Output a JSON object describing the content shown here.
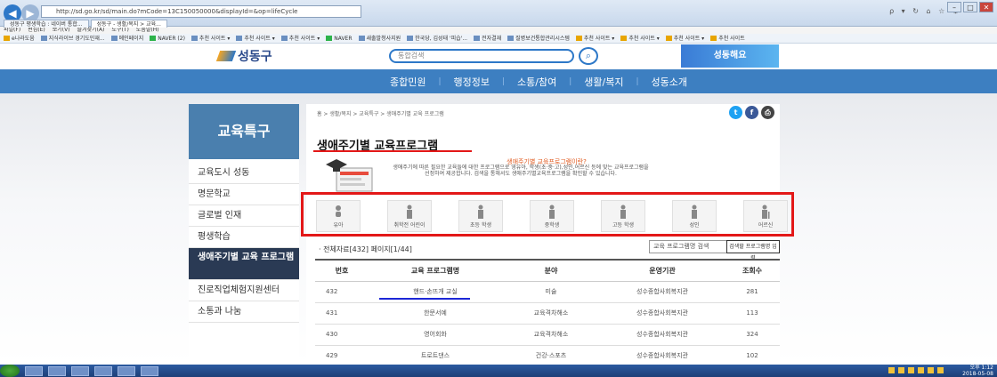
{
  "browser": {
    "url": "http://sd.go.kr/sd/main.do?mCode=13C150050000&displayId=&op=lifeCycle",
    "tab_label": "성동구 평생학습 : 네이버 통합...",
    "tab_active_label": "성동구 - 생활/복지 > 교육...",
    "menu": [
      "파일(F)",
      "편집(E)",
      "보기(V)",
      "즐겨찾기(A)",
      "도구(T)",
      "도움말(H)"
    ],
    "favorites": [
      "e나라도움",
      "지식라이브 경기도민재...",
      "메인페이지",
      "NAVER (2)",
      "추천 사이트 ▾",
      "추천 사이트 ▾",
      "추천 사이트 ▾",
      "NAVER",
      "새출발청사지원",
      "한국당, 김성태 '피습'...",
      "전자결재",
      "질병보건통합관리시스템",
      "추천 사이트 ▾",
      "추천 사이트 ▾",
      "추천 사이트 ▾",
      "추천 사이트"
    ]
  },
  "site": {
    "logo": "성동구",
    "search_placeholder": "통합검색",
    "banner": "성동해요",
    "gnb": [
      "종합민원",
      "행정정보",
      "소통/참여",
      "생활/복지",
      "성동소개"
    ]
  },
  "sidebar": {
    "title": "교육특구",
    "items": [
      {
        "label": "교육도시 성동"
      },
      {
        "label": "명문학교"
      },
      {
        "label": "글로벌 인재"
      },
      {
        "label": "평생학습"
      },
      {
        "label": "생애주기별 교육 프로그램"
      },
      {
        "label": "진로직업체험지원센터"
      },
      {
        "label": "소통과 나눔"
      }
    ]
  },
  "page": {
    "breadcrumb": "홈 > 생활/복지 > 교육특구 > 생애주기별 교육 프로그램",
    "title": "생애주기별 교육프로그램",
    "intro_title": "생애주기별 교육프로그램이란?",
    "intro_text": "생애주기에 따른 필요한 교육들에 대한 프로그램으로 영유아, 학생(초·중·고),성인,어르신 등에 맞는 교육프로그램을 선정하여 제공합니다. 검색을 통해서도 생애주기별교육프로그램을 확인할 수 있습니다."
  },
  "life_stages": [
    "유아",
    "취학전 어린이",
    "초등 학생",
    "중학생",
    "고등 학생",
    "성인",
    "어르신"
  ],
  "list": {
    "summary": "· 전체자료[432] 페이지[1/44]",
    "search_value": "교육 프로그램명 검색",
    "search_button": "검색할 프로그램명 입력",
    "columns": [
      "번호",
      "교육 프로그램명",
      "분야",
      "운영기관",
      "조회수"
    ],
    "rows": [
      [
        "432",
        "핸드·손뜨개 교실",
        "미술",
        "성수종합사회복지관",
        "281"
      ],
      [
        "431",
        "한문서예",
        "교육격차해소",
        "성수종합사회복지관",
        "113"
      ],
      [
        "430",
        "영어회화",
        "교육격차해소",
        "성수종합사회복지관",
        "324"
      ],
      [
        "429",
        "트로트댄스",
        "건강·스포츠",
        "성수종합사회복지관",
        "102"
      ]
    ]
  },
  "taskbar": {
    "time": "오후 1:12",
    "date": "2018-05-08"
  },
  "colors": {
    "accent": "#3d7fc1",
    "highlight": "#e31818",
    "underline": "#1c27d6",
    "sidebar_head": "#4a7fae"
  }
}
